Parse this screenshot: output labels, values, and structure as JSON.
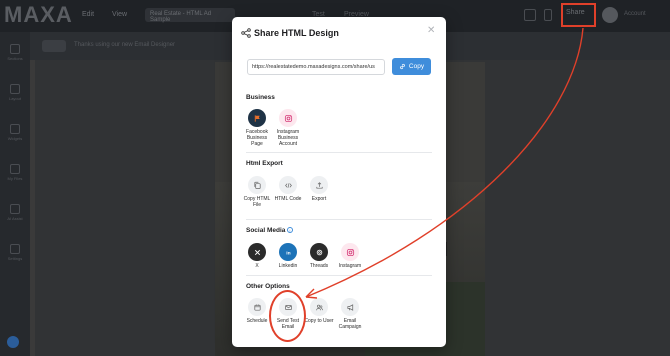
{
  "app": {
    "logo": "MAXA",
    "tabs": [
      "Edit",
      "View"
    ],
    "design_name": "Real Estate - HTML Ad Sample",
    "toolbar_misc": [
      "Test",
      "Preview"
    ],
    "share_label": "Share",
    "user_label": "Account"
  },
  "sidebar": {
    "items": [
      "Sections",
      "Layout",
      "Widgets",
      "My Files",
      "AI Assist",
      "Settings"
    ]
  },
  "subbar": {
    "chip": "Mobile",
    "text": "Thanks using our new Email Designer"
  },
  "modal": {
    "title": "Share HTML Design",
    "url": "https://realestatedemo.maxadesigns.com/share/us",
    "copy_label": "Copy",
    "sections": {
      "business": {
        "title": "Business",
        "items": [
          {
            "label": "Facebook Business Page",
            "icon": "flag-icon"
          },
          {
            "label": "Instagram Business Account",
            "icon": "instagram-icon"
          }
        ]
      },
      "html_export": {
        "title": "Html Export",
        "items": [
          {
            "label": "Copy HTML File",
            "icon": "copy-icon"
          },
          {
            "label": "HTML Code",
            "icon": "code-icon"
          },
          {
            "label": "Export",
            "icon": "upload-icon"
          }
        ]
      },
      "social_media": {
        "title": "Social Media",
        "items": [
          {
            "label": "X",
            "icon": "x-icon"
          },
          {
            "label": "Linkedin",
            "icon": "linkedin-icon"
          },
          {
            "label": "Threads",
            "icon": "threads-icon"
          },
          {
            "label": "Instagram",
            "icon": "instagram-icon"
          }
        ]
      },
      "other_options": {
        "title": "Other Options",
        "items": [
          {
            "label": "Schedule",
            "icon": "calendar-icon"
          },
          {
            "label": "Send Test Email",
            "icon": "mail-icon"
          },
          {
            "label": "Copy to User",
            "icon": "users-icon"
          },
          {
            "label": "Email Campaign",
            "icon": "megaphone-icon"
          }
        ]
      }
    }
  },
  "colors": {
    "accent": "#3f8ddb",
    "annotation": "#e0402a"
  }
}
